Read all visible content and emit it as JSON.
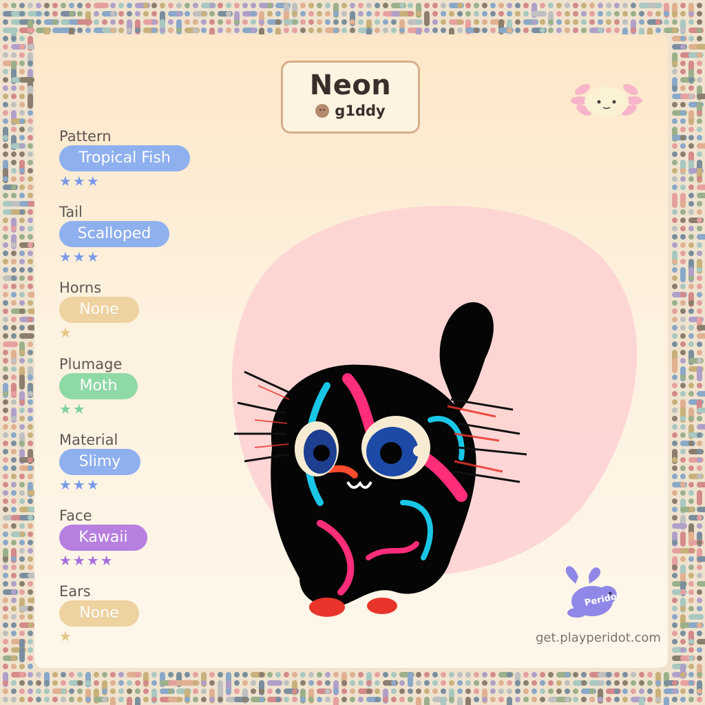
{
  "creature": {
    "name": "Neon",
    "creator": "g1ddy"
  },
  "traits": [
    {
      "label": "Pattern",
      "value": "Tropical Fish",
      "rarity": 3,
      "color": "#8fb0ef",
      "stars": "★★★",
      "star_color": "#7a9ae8"
    },
    {
      "label": "Tail",
      "value": "Scalloped",
      "rarity": 3,
      "color": "#8fb0ef",
      "stars": "★★★",
      "star_color": "#7a9ae8"
    },
    {
      "label": "Horns",
      "value": "None",
      "rarity": 1,
      "color": "#eed29f",
      "stars": "★",
      "star_color": "#e6c688"
    },
    {
      "label": "Plumage",
      "value": "Moth",
      "rarity": 2,
      "color": "#8fd9a7",
      "stars": "★★",
      "star_color": "#7dd19a"
    },
    {
      "label": "Material",
      "value": "Slimy",
      "rarity": 3,
      "color": "#8fb0ef",
      "stars": "★★★",
      "star_color": "#7a9ae8"
    },
    {
      "label": "Face",
      "value": "Kawaii",
      "rarity": 4,
      "color": "#b77fe0",
      "stars": "★★★★",
      "star_color": "#a86fdc"
    },
    {
      "label": "Ears",
      "value": "None",
      "rarity": 1,
      "color": "#eed29f",
      "stars": "★",
      "star_color": "#e6c688"
    }
  ],
  "branding": {
    "logo_text": "Peridot",
    "url": "get.playperidot.com"
  },
  "icons": {
    "species": "axolotl-icon",
    "logo": "peridot-bunny-logo"
  },
  "colors": {
    "background": "#fdf1df",
    "blob": "#fdd3d3",
    "name_card_border": "#d6ae8b"
  }
}
